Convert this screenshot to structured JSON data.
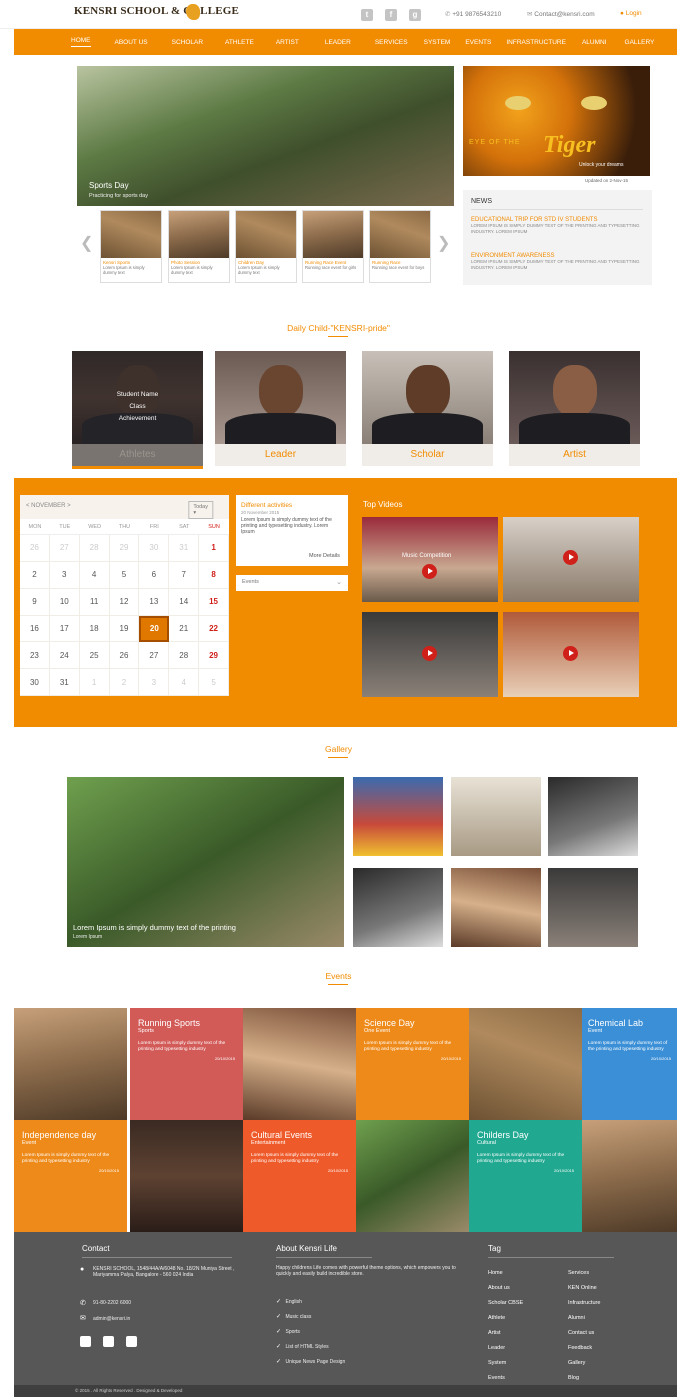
{
  "header": {
    "logo_title": "KENSRI SCHOOL & COLLEGE",
    "logo_tagline": "",
    "phone": "+91 9876543210",
    "email": "Contact@kensri.com",
    "login": "Login"
  },
  "nav": [
    "HOME",
    "ABOUT US",
    "SCHOLAR",
    "ATHLETE",
    "ARTIST",
    "LEADER",
    "SERVICES",
    "SYSTEM",
    "EVENTS",
    "INFRASTRUCTURE",
    "ALUMNI",
    "GALLERY"
  ],
  "hero": {
    "caption": "Sports Day",
    "subcaption": "Practicing for sports day"
  },
  "thumbs": [
    {
      "title": "Kensri Sports",
      "desc": "Lorem Ipsum is simply dummy text"
    },
    {
      "title": "Photo Session",
      "desc": "Lorem Ipsum is simply dummy text"
    },
    {
      "title": "Children Day",
      "desc": "Lorem Ipsum is simply dummy text"
    },
    {
      "title": "Running Race Event",
      "desc": "Running race event for girls"
    },
    {
      "title": "Running Race",
      "desc": "Running race event for boys"
    }
  ],
  "tiger": {
    "eye_of": "EYE OF THE",
    "tiger": "Tiger",
    "sub": "Unlock your dreams",
    "caption": "Updated on 2-Nov-15"
  },
  "news": {
    "heading": "NEWS",
    "items": [
      {
        "title": "EDUCATIONAL TRIP FOR STD IV STUDENTS",
        "desc": "LOREM IPSUM IS SIMPLY DUMMY TEXT OF THE PRINTING AND TYPESETTING INDUSTRY. LOREM IPSUM"
      },
      {
        "title": "ENVIRONMENT AWARENESS",
        "desc": "LOREM IPSUM IS SIMPLY DUMMY TEXT OF THE PRINTING AND TYPESETTING INDUSTRY. LOREM IPSUM"
      }
    ]
  },
  "daily": {
    "title": "Daily Child-\"KENSRI-pride\"",
    "overlay": [
      "Student Name",
      "Class",
      "Achievement"
    ],
    "cards": [
      "Athletes",
      "Leader",
      "Scholar",
      "Artist"
    ]
  },
  "calendar": {
    "month": "< NOVEMBER >",
    "today": "Today",
    "weekdays": [
      "MON",
      "TUE",
      "WED",
      "THU",
      "FRI",
      "SAT",
      "SUN"
    ],
    "days": [
      "26",
      "27",
      "28",
      "29",
      "30",
      "31",
      "1",
      "2",
      "3",
      "4",
      "5",
      "6",
      "7",
      "8",
      "9",
      "10",
      "11",
      "12",
      "13",
      "14",
      "15",
      "16",
      "17",
      "18",
      "19",
      "20",
      "21",
      "22",
      "23",
      "24",
      "25",
      "26",
      "27",
      "28",
      "29",
      "30",
      "31",
      "1",
      "2",
      "3",
      "4",
      "5"
    ]
  },
  "activity": {
    "title": "Different activities",
    "date": "20 November 2015",
    "body": "Lorem Ipsum is simply dummy text of the printing and typesetting industry. Lorem Ipsum",
    "more": "More Details"
  },
  "events_select": "Events",
  "videos": {
    "title": "Top Videos",
    "caption": "Music Competition"
  },
  "gallery": {
    "title": "Gallery",
    "caption": "Lorem Ipsum is simply dummy text of the printing",
    "sub": "Lorem Ipsum"
  },
  "events": {
    "title": "Events",
    "items": [
      {
        "h": "Running Sports",
        "s": "Sports",
        "d": "Lorem Ipsum is simply dummy text of the printing and typesetting industry",
        "date": "20/10/2015"
      },
      {
        "h": "Science Day",
        "s": "One Event",
        "d": "Lorem Ipsum is simply dummy text of the printing and typesetting industry",
        "date": "20/10/2015"
      },
      {
        "h": "Chemical Lab",
        "s": "Event",
        "d": "Lorem Ipsum is simply dummy text of the printing and typesetting industry",
        "date": "20/10/2015"
      },
      {
        "h": "Independence day",
        "s": "Event",
        "d": "Lorem Ipsum is simply dummy text of the printing and typesetting industry",
        "date": "20/10/2015"
      },
      {
        "h": "Cultural Events",
        "s": "Entertainment",
        "d": "Lorem Ipsum is simply dummy text of the printing and typesetting industry",
        "date": "20/10/2015"
      },
      {
        "h": "Childers Day",
        "s": "Cultural",
        "d": "Lorem Ipsum is simply dummy text of the printing and typesetting industry",
        "date": "20/10/2015"
      }
    ]
  },
  "footer": {
    "contact_title": "Contact",
    "address": "KENSRI SCHOOL, 1548/44A/A/6048 No. 18/2N Muniya Street , Mariyamma Palya, Bangalore - 560 024 India",
    "phone": "91-80-2202 6000",
    "email": "admin@kensri.in",
    "about_title": "About Kensri Life",
    "about_text": "Happy childrens Life comes with powerful theme options, which empowers you to quickly and easily build incredible store.",
    "checks": [
      "English",
      "Music class",
      "Sports",
      "List of HTML Styles",
      "Unique News Page Design"
    ],
    "tag_title": "Tag",
    "tags_left": [
      "Home",
      "About us",
      "Scholar CBSE",
      "Athlete",
      "Artist",
      "Leader",
      "System",
      "Events"
    ],
    "tags_right": [
      "Services",
      "KEN Online",
      "Infrastructure",
      "Alumni",
      "Contact us",
      "Feedback",
      "Gallery",
      "Blog"
    ],
    "copyright": "© 2015 . All Rights Reserved . Designed & Developed"
  }
}
